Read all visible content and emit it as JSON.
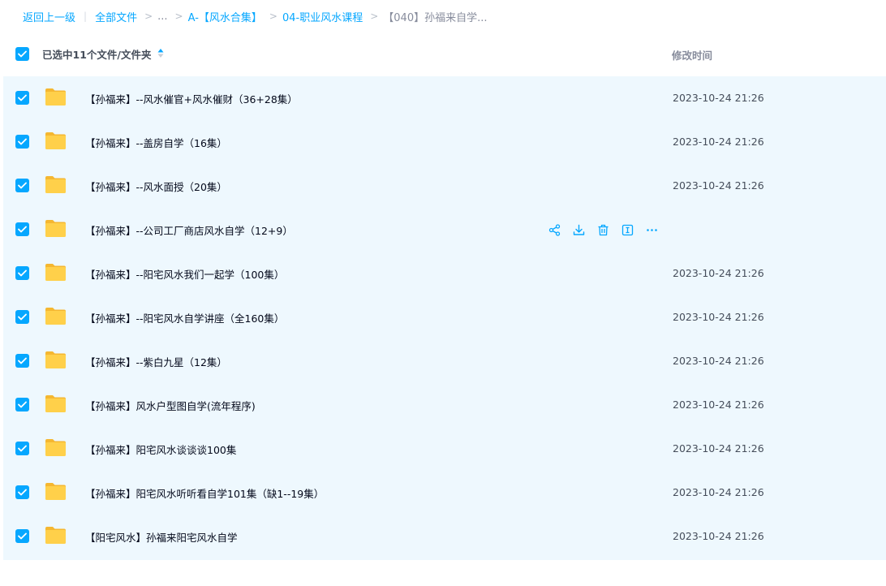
{
  "breadcrumb": {
    "back": "返回上一级",
    "divider": "|",
    "sep": ">",
    "all_files": "全部文件",
    "ellipsis": "...",
    "level1": "A-【风水合集】",
    "level2": "04-职业风水课程",
    "current": "【040】孙福来自学..."
  },
  "header": {
    "selection_label": "已选中11个文件/文件夹",
    "time_label": "修改时间"
  },
  "rows": [
    {
      "name": "【孙福来】--风水催官+风水催财（36+28集）",
      "time": "2023-10-24 21:26"
    },
    {
      "name": "【孙福来】--盖房自学（16集）",
      "time": "2023-10-24 21:26"
    },
    {
      "name": "【孙福来】--风水面授（20集）",
      "time": "2023-10-24 21:26"
    },
    {
      "name": "【孙福来】--公司工厂商店风水自学（12+9）",
      "time": ""
    },
    {
      "name": "【孙福来】--阳宅风水我们一起学（100集）",
      "time": "2023-10-24 21:26"
    },
    {
      "name": "【孙福来】--阳宅风水自学讲座（全160集）",
      "time": "2023-10-24 21:26"
    },
    {
      "name": "【孙福来】--紫白九星（12集）",
      "time": "2023-10-24 21:26"
    },
    {
      "name": "【孙福来】风水户型图自学(流年程序)",
      "time": "2023-10-24 21:26"
    },
    {
      "name": "【孙福来】阳宅风水谈谈谈100集",
      "time": "2023-10-24 21:26"
    },
    {
      "name": "【孙福来】阳宅风水听听看自学101集（缺1--19集）",
      "time": "2023-10-24 21:26"
    },
    {
      "name": "【阳宅风水】孙福来阳宅风水自学",
      "time": "2023-10-24 21:26"
    }
  ],
  "hover_actions": [
    "share-icon",
    "download-icon",
    "delete-icon",
    "rename-icon",
    "more-icon"
  ],
  "colors": {
    "accent": "#06a7ff",
    "row_selected_bg": "#eef8fe",
    "folder_yellow": "#ffd04a"
  }
}
